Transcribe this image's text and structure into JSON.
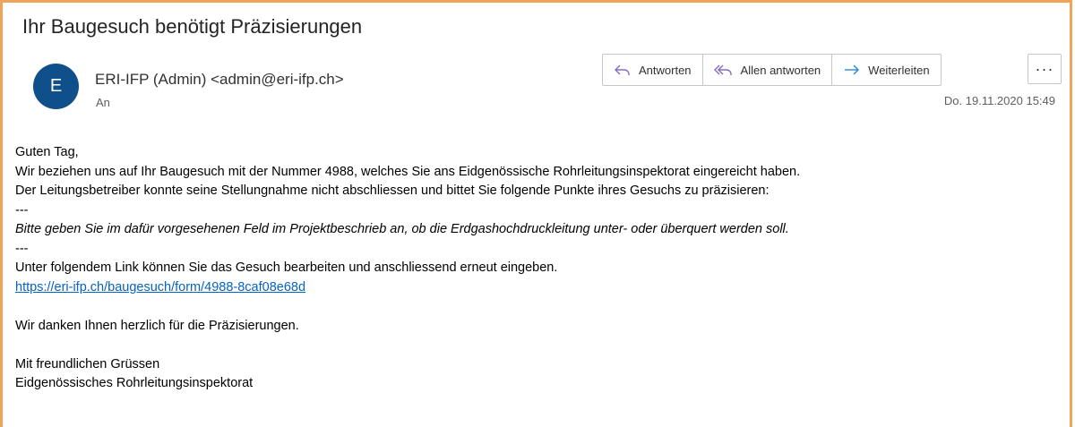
{
  "email": {
    "subject": "Ihr Baugesuch benötigt Präzisierungen",
    "avatar_initial": "E",
    "sender": "ERI-IFP (Admin) <admin@eri-ifp.ch>",
    "to_label": "An",
    "date": "Do. 19.11.2020 15:49"
  },
  "actions": {
    "reply_label": "Antworten",
    "reply_all_label": "Allen antworten",
    "forward_label": "Weiterleiten",
    "more_label": "···",
    "reply_icon": "reply-icon",
    "reply_all_icon": "reply-all-icon",
    "forward_icon": "forward-icon"
  },
  "body": {
    "greeting": "Guten Tag,",
    "line1": "Wir beziehen uns auf Ihr Baugesuch mit der Nummer 4988, welches Sie ans Eidgenössische Rohrleitungsinspektorat eingereicht haben.",
    "line2": "Der Leitungsbetreiber konnte seine Stellungnahme nicht abschliessen und bittet Sie folgende Punkte ihres Gesuchs zu präzisieren:",
    "separator1": "---",
    "request": "Bitte geben Sie im dafür vorgesehenen Feld im Projektbeschrieb an, ob die Erdgashochdruckleitung unter- oder überquert werden soll.",
    "separator2": "---",
    "link_intro": "Unter folgendem Link können Sie das Gesuch bearbeiten und anschliessend erneut eingeben.",
    "link": "https://eri-ifp.ch/baugesuch/form/4988-8caf08e68d",
    "thanks": "Wir danken Ihnen herzlich für die Präzisierungen.",
    "closing": "Mit freundlichen Grüssen",
    "signature": "Eidgenössisches Rohrleitungsinspektorat"
  },
  "colors": {
    "frame_border": "#f0a45a",
    "avatar_bg": "#0f4f8a",
    "reply_icon": "#8a6abf",
    "forward_icon": "#2b88d8",
    "link": "#0563c1"
  }
}
